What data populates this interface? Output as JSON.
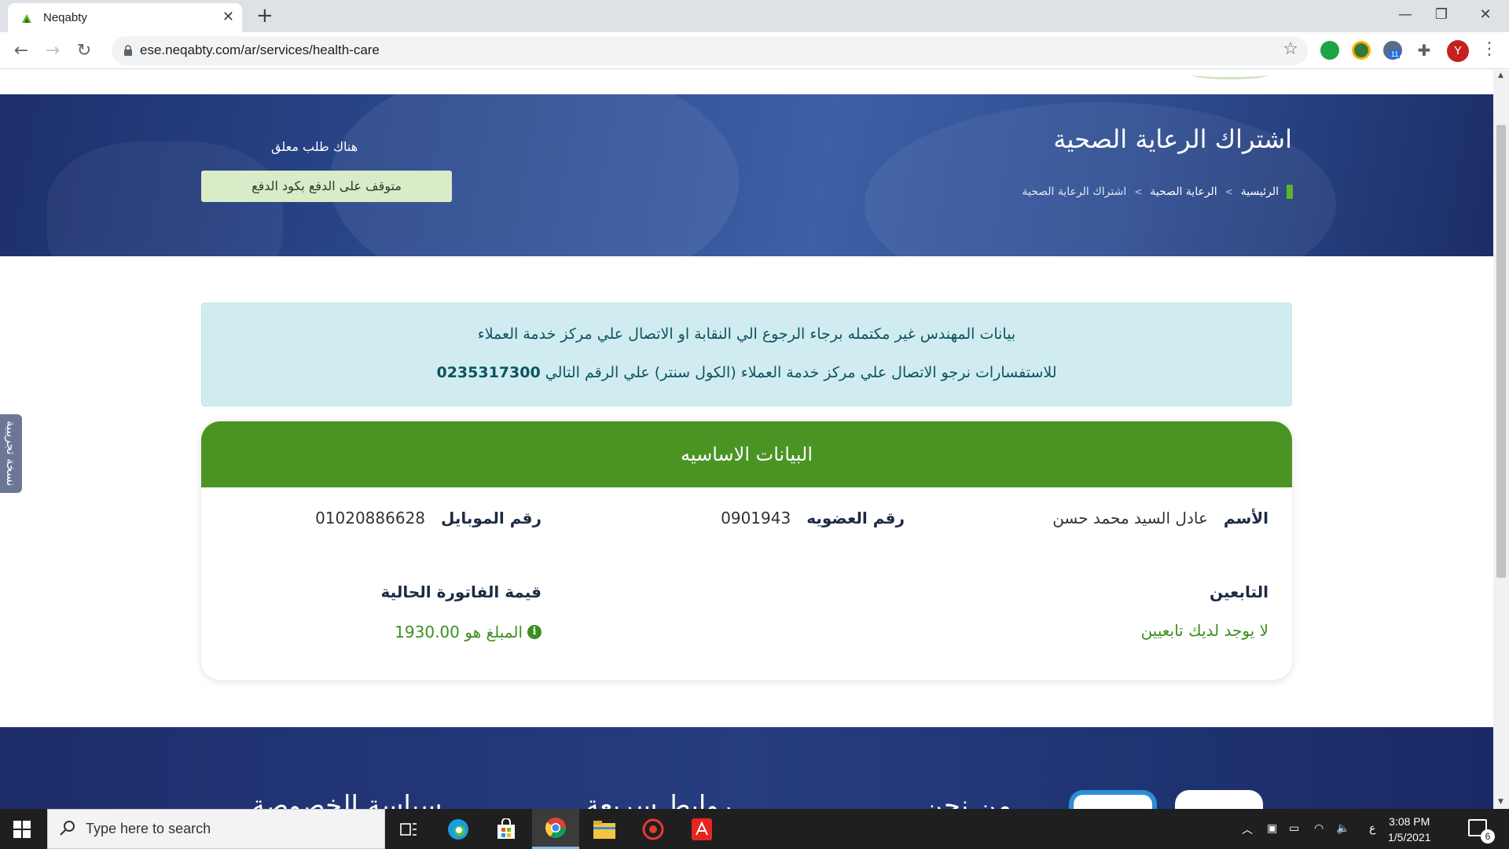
{
  "browser": {
    "tab_title": "Neqabty",
    "url": "ese.neqabty.com/ar/services/health-care",
    "profile_initial": "Y",
    "extension_badge": "11"
  },
  "hero": {
    "title": "اشتراك الرعاية الصحية",
    "breadcrumb": [
      "الرئيسية",
      "الرعاية الصحية",
      "اشتراك الرعاية الصحية"
    ],
    "breadcrumb_separator": ">",
    "pending_label": "هناك طلب معلق",
    "pending_button": "متوقف على الدفع بكود الدفع"
  },
  "alert": {
    "line1": "بيانات المهندس غير مكتمله برجاء الرجوع الي النقابة او الاتصال علي مركز خدمة العملاء",
    "line2_text": "للاستفسارات نرجو الاتصال علي مركز خدمة العملاء (الكول سنتر) علي الرقم التالي",
    "phone": "0235317300"
  },
  "card": {
    "header": "البيانات الاساسيه",
    "name_label": "الأسم",
    "name_value": "عادل السيد محمد حسن",
    "membership_label": "رقم العضويه",
    "membership_value": "0901943",
    "mobile_label": "رقم الموبايل",
    "mobile_value": "01020886628",
    "dependents_label": "التابعين",
    "dependents_value": "لا يوجد لديك تابعيين",
    "invoice_label": "قيمة الفاتورة الحالية",
    "invoice_value": "المبلغ هو 1930.00"
  },
  "side_tab": "نسخة تجريبية",
  "footer": {
    "headings": [
      "من نحن",
      "روابط سريعة",
      "سياسة الخصوصة"
    ]
  },
  "taskbar": {
    "search_placeholder": "Type here to search",
    "time": "3:08 PM",
    "date": "1/5/2021",
    "input_lang": "ع",
    "notification_count": "6"
  },
  "colors": {
    "brand_green": "#4a9424",
    "hero_blue": "#2b4a8f",
    "alert_bg": "#d1ecf1"
  }
}
